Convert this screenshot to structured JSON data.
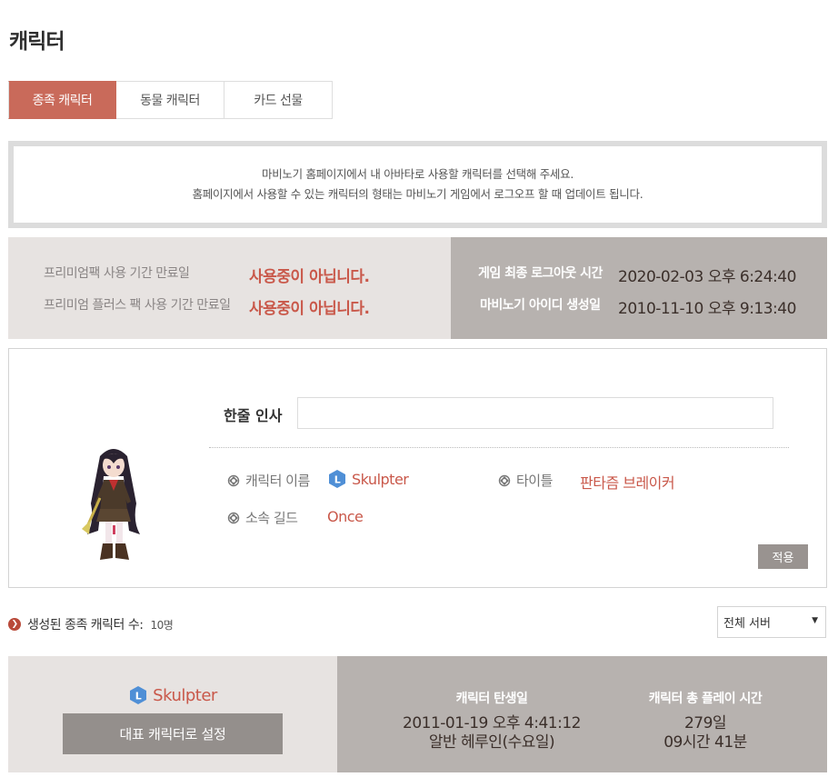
{
  "page": {
    "title": "캐릭터"
  },
  "tabs": [
    {
      "label": "종족 캐릭터",
      "active": true
    },
    {
      "label": "동물 캐릭터",
      "active": false
    },
    {
      "label": "카드 선물",
      "active": false
    }
  ],
  "notice": {
    "line1": "마비노기 홈페이지에서 내 아바타로 사용할 캐릭터를 선택해 주세요.",
    "line2": "홈페이지에서 사용할 수 있는 캐릭터의 형태는 마비노기 게임에서 로그오프 할 때 업데이트 됩니다."
  },
  "status": {
    "premium_label": "프리미엄팩 사용 기간 만료일",
    "premium_value": "사용중이 아닙니다.",
    "premium_plus_label": "프리미엄 플러스 팩 사용 기간 만료일",
    "premium_plus_value": "사용중이 아닙니다.",
    "last_logout_label": "게임 최종 로그아웃 시간",
    "last_logout_value": "2020-02-03 오후 6:24:40",
    "id_created_label": "마비노기 아이디 생성일",
    "id_created_value": "2010-11-10 오후 9:13:40"
  },
  "profile": {
    "greeting_label": "한줄 인사",
    "greeting_value": "",
    "char_name_label": "캐릭터 이름",
    "char_name_badge": "L",
    "char_name_value": "Skulpter",
    "title_label": "타이틀",
    "title_value": "판타즘 브레이커",
    "guild_label": "소속 길드",
    "guild_value": "Once",
    "apply_label": "적용"
  },
  "list": {
    "count_label": "생성된 종족 캐릭터 수:",
    "count_value": "10명",
    "server_select": "전체 서버"
  },
  "card": {
    "badge": "L",
    "name": "Skulpter",
    "rep_button": "대표 캐릭터로 설정",
    "birth_label": "캐릭터 탄생일",
    "birth_line1": "2011-01-19 오후 4:41:12",
    "birth_line2": "알반 헤루인(수요일)",
    "playtime_label": "캐릭터 총 플레이 시간",
    "playtime_line1": "279일",
    "playtime_line2": "09시간 41분"
  },
  "colors": {
    "accent": "#c96a5a",
    "value_red": "#c9584a",
    "panel_light": "#e7e3e1",
    "panel_dark": "#b7b2af",
    "badge_blue": "#4f8fd6"
  }
}
